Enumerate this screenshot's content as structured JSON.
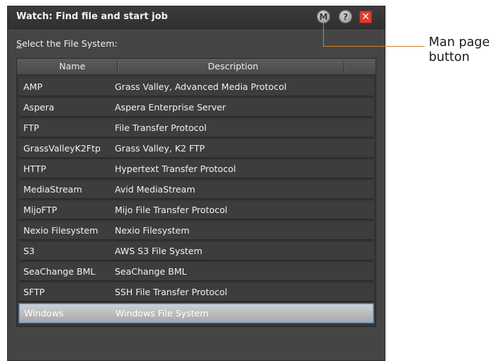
{
  "window": {
    "title": "Watch: Find file and start job",
    "man_label": "M",
    "help_label": "?",
    "close_label": "✕"
  },
  "select_label": {
    "first_letter": "S",
    "rest": "elect the File System:"
  },
  "table": {
    "columns": [
      "Name",
      "Description"
    ],
    "rows": [
      {
        "name": "AMP",
        "description": "Grass Valley, Advanced Media Protocol"
      },
      {
        "name": "Aspera",
        "description": "Aspera Enterprise Server"
      },
      {
        "name": "FTP",
        "description": "File Transfer Protocol"
      },
      {
        "name": "GrassValleyK2Ftp",
        "description": "Grass Valley, K2 FTP"
      },
      {
        "name": "HTTP",
        "description": "Hypertext Transfer Protocol"
      },
      {
        "name": "MediaStream",
        "description": "Avid MediaStream"
      },
      {
        "name": "MijoFTP",
        "description": "Mijo File Transfer Protocol"
      },
      {
        "name": "Nexio Filesystem",
        "description": "Nexio Filesystem"
      },
      {
        "name": "S3",
        "description": "AWS S3 File System"
      },
      {
        "name": "SeaChange BML",
        "description": "SeaChange BML"
      },
      {
        "name": "SFTP",
        "description": "SSH File Transfer Protocol"
      },
      {
        "name": "Windows",
        "description": "Windows File System"
      }
    ],
    "selected_index": 11
  },
  "callout": {
    "line1": "Man page",
    "line2": "button"
  },
  "colors": {
    "accent_selection": "#7da4c9",
    "close_button": "#e03a2a",
    "callout_line": "#c8832a"
  }
}
